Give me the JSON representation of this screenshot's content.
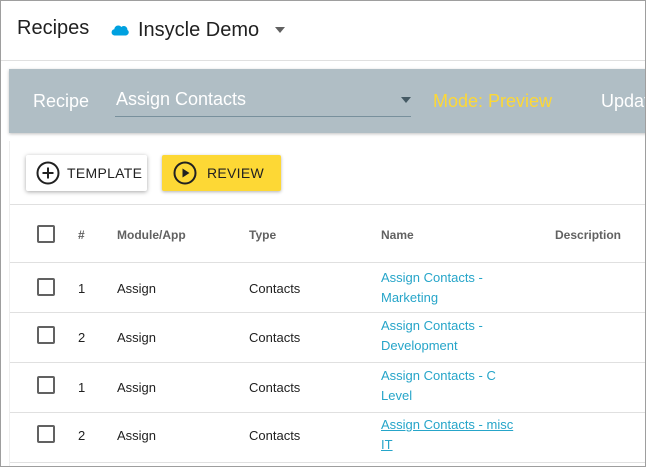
{
  "header": {
    "app_title": "Recipes",
    "org_name": "Insycle Demo",
    "org_icon": "salesforce-cloud-icon"
  },
  "recipe_bar": {
    "label": "Recipe",
    "selected_recipe": "Assign Contacts",
    "mode": "Mode: Preview",
    "update_label": "Update"
  },
  "toolbar": {
    "template_label": "TEMPLATE",
    "review_label": "REVIEW"
  },
  "table": {
    "columns": [
      "#",
      "Module/App",
      "Type",
      "Name",
      "Description"
    ],
    "rows": [
      {
        "num": "1",
        "module": "Assign",
        "type": "Contacts",
        "name_line1": "Assign Contacts -",
        "name_line2": "Marketing"
      },
      {
        "num": "2",
        "module": "Assign",
        "type": "Contacts",
        "name_line1": "Assign Contacts -",
        "name_line2": "Development"
      },
      {
        "num": "1",
        "module": "Assign",
        "type": "Contacts",
        "name_line1": "Assign Contacts - C",
        "name_line2": "Level"
      },
      {
        "num": "2",
        "module": "Assign",
        "type": "Contacts",
        "name_line1": "Assign Contacts - misc",
        "name_line2": "IT"
      }
    ]
  },
  "colors": {
    "recipe_bar_bg": "#b0bec5",
    "mode_text": "#fdd835",
    "review_button": "#fdd835",
    "link": "#26a5c9",
    "salesforce_blue": "#00a1e0"
  }
}
